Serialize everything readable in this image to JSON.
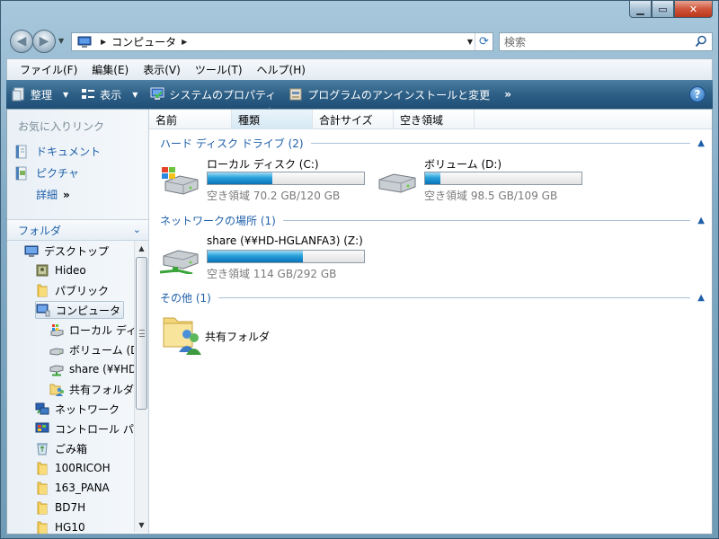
{
  "address": {
    "path": "コンピュータ"
  },
  "search": {
    "placeholder": "検索"
  },
  "menu": {
    "items": [
      "ファイル(F)",
      "編集(E)",
      "表示(V)",
      "ツール(T)",
      "ヘルプ(H)"
    ]
  },
  "toolbar": {
    "organize": "整理",
    "views": "表示",
    "system_properties": "システムのプロパティ",
    "uninstall": "プログラムのアンインストールと変更",
    "more": "»"
  },
  "nav_pane": {
    "favorites_heading": "お気に入りリンク",
    "favorites": [
      "ドキュメント",
      "ピクチャ"
    ],
    "more_label": "詳細",
    "folders_label": "フォルダ",
    "tree": [
      {
        "label": "デスクトップ",
        "icon": "desktop-icon"
      },
      {
        "label": "Hideo",
        "icon": "user-folder-icon"
      },
      {
        "label": "パブリック",
        "icon": "folder-icon"
      },
      {
        "label": "コンピュータ",
        "icon": "computer-icon",
        "selected": true
      },
      {
        "label": "ローカル ディ",
        "icon": "local-disk-icon"
      },
      {
        "label": "ボリューム (D",
        "icon": "hard-drive-icon"
      },
      {
        "label": "share (¥¥HD-",
        "icon": "network-drive-icon"
      },
      {
        "label": "共有フォルダ",
        "icon": "shared-folder-icon"
      },
      {
        "label": "ネットワーク",
        "icon": "network-icon"
      },
      {
        "label": "コントロール パ",
        "icon": "control-panel-icon"
      },
      {
        "label": "ごみ箱",
        "icon": "recycle-bin-icon"
      },
      {
        "label": "100RICOH",
        "icon": "folder-icon"
      },
      {
        "label": "163_PANA",
        "icon": "folder-icon"
      },
      {
        "label": "BD7H",
        "icon": "folder-icon"
      },
      {
        "label": "HG10",
        "icon": "folder-icon"
      }
    ]
  },
  "columns": [
    "名前",
    "種類",
    "合計サイズ",
    "空き領域"
  ],
  "groups": {
    "hard_disk": "ハード ディスク ドライブ (2)",
    "network": "ネットワークの場所 (1)",
    "other": "その他 (1)"
  },
  "drives": {
    "c": {
      "name": "ローカル ディスク (C:)",
      "free": "空き領域 70.2 GB/120 GB",
      "used_fraction": 0.415
    },
    "d": {
      "name": "ボリューム (D:)",
      "free": "空き領域 98.5 GB/109 GB",
      "used_fraction": 0.096
    },
    "z": {
      "name": "share (¥¥HD-HGLANFA3) (Z:)",
      "free": "空き領域 114 GB/292 GB",
      "used_fraction": 0.61
    }
  },
  "other_items": {
    "shared_folder": "共有フォルダ"
  }
}
